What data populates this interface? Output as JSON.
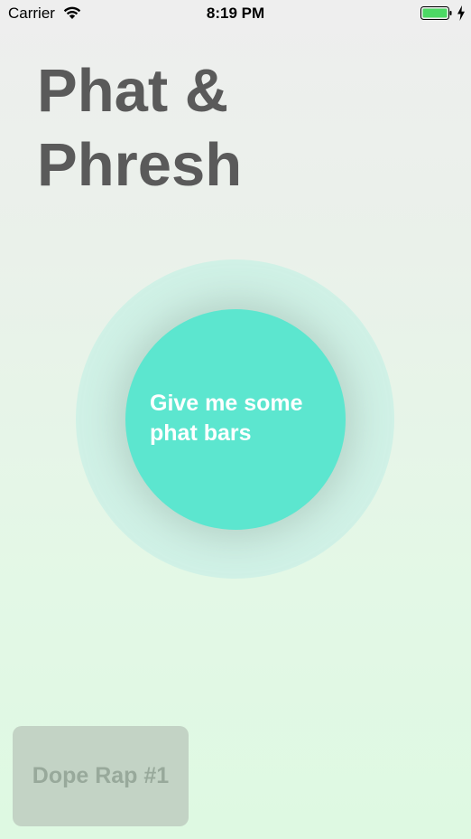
{
  "status_bar": {
    "carrier": "Carrier",
    "time": "8:19 PM",
    "wifi_icon": "wifi-icon",
    "battery_icon": "battery-icon",
    "charging_icon": "charging-bolt-icon",
    "battery_level": 1.0,
    "battery_color": "#4cd964"
  },
  "header": {
    "title_line1": "Phat &",
    "title_line2": "Phresh",
    "title_color": "#5a5a5a"
  },
  "main_action": {
    "label": "Give me some phat bars",
    "button_color": "#5ce6cf",
    "ring_color": "#d0f1e6"
  },
  "saved_raps": {
    "items": [
      {
        "label": "Dope Rap #1"
      }
    ],
    "button_color": "#c3d3c5",
    "text_color": "#98a99b"
  }
}
